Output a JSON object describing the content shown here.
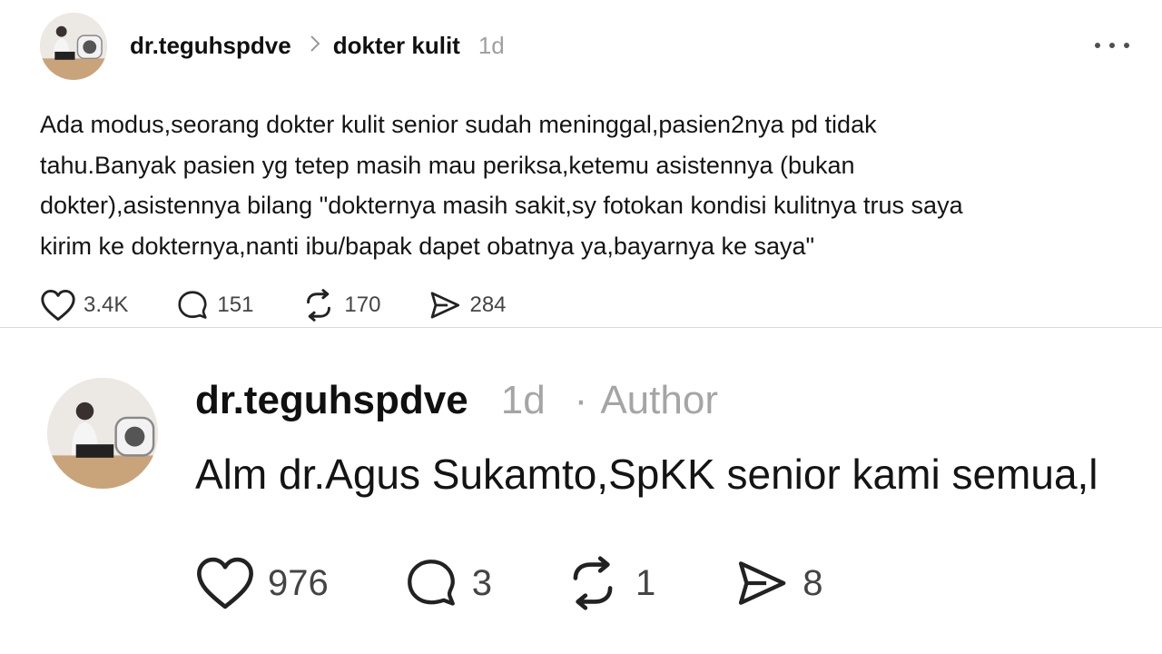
{
  "post": {
    "username": "dr.teguhspdve",
    "topic": "dokter kulit",
    "time": "1d",
    "text": "Ada modus,seorang dokter kulit senior sudah meninggal,pasien2nya pd tidak\ntahu.Banyak pasien yg tetep masih mau periksa,ketemu asistennya (bukan\ndokter),asistennya bilang \"dokternya masih sakit,sy fotokan kondisi kulitnya trus saya\nkirim ke dokternya,nanti ibu/bapak dapet obatnya ya,bayarnya ke saya\"",
    "likes": "3.4K",
    "replies": "151",
    "reposts": "170",
    "shares": "284",
    "more_icon": "more-horizontal-icon"
  },
  "reply": {
    "username": "dr.teguhspdve",
    "time": "1d",
    "separator": "·",
    "badge": "Author",
    "text": "Alm dr.Agus Sukamto,SpKK senior kami semua,l",
    "likes": "976",
    "replies": "3",
    "reposts": "1",
    "shares": "8"
  },
  "icons": {
    "like": "heart-icon",
    "reply": "comment-icon",
    "repost": "repost-icon",
    "share": "share-send-icon",
    "chevron": "chevron-right-icon"
  },
  "colors": {
    "text": "#101010",
    "muted": "#a0a0a0",
    "divider": "#d9d9d9",
    "background": "#ffffff"
  }
}
